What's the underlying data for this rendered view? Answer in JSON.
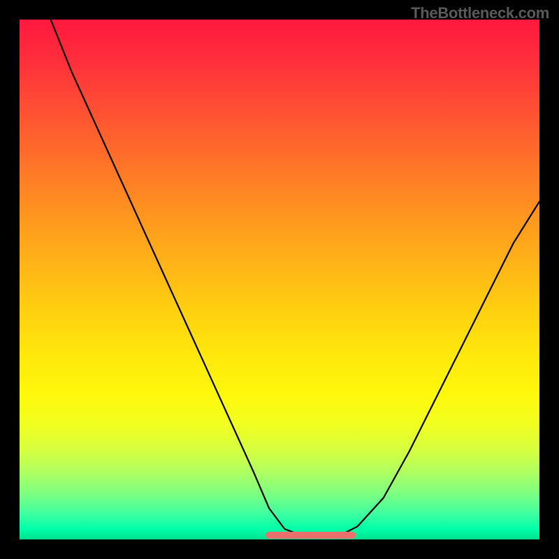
{
  "attribution": "TheBottleneck.com",
  "chart_data": {
    "type": "line",
    "title": "",
    "xlabel": "",
    "ylabel": "",
    "xlim": [
      0,
      100
    ],
    "ylim": [
      0,
      100
    ],
    "series": [
      {
        "name": "bottleneck-curve",
        "x": [
          6,
          10,
          15,
          20,
          25,
          30,
          35,
          40,
          45,
          48,
          51,
          55,
          59,
          62,
          65,
          70,
          75,
          80,
          85,
          90,
          95,
          100
        ],
        "y": [
          100,
          90,
          79,
          68,
          57,
          46,
          35,
          24,
          13,
          6,
          2,
          0.5,
          0.5,
          1,
          2.5,
          8,
          17,
          27,
          37,
          47,
          57,
          65
        ]
      }
    ],
    "highlight": {
      "name": "optimal-range",
      "x_range": [
        48,
        64
      ],
      "y": 0.8,
      "color": "#e8716e"
    },
    "background_gradient": {
      "top": "#ff183f",
      "middle": "#ffe60c",
      "bottom": "#00e090"
    }
  }
}
